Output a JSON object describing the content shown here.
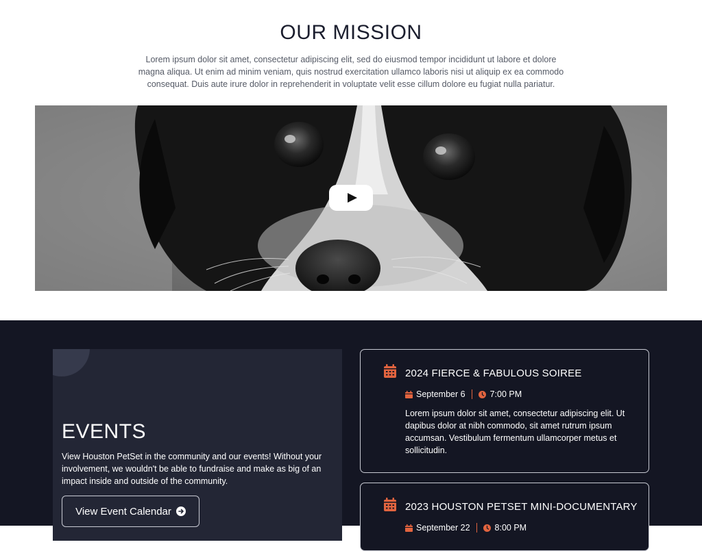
{
  "mission": {
    "title": "OUR MISSION",
    "text": "Lorem ipsum dolor sit amet, consectetur adipiscing elit, sed do eiusmod tempor incididunt ut labore et dolore magna aliqua. Ut enim ad minim veniam, quis nostrud exercitation ullamco laboris nisi ut aliquip ex ea commodo consequat. Duis aute irure dolor in reprehenderit in voluptate velit esse cillum dolore eu fugiat nulla pariatur.",
    "video": {
      "play_icon": "play-icon",
      "subject": "black-and-white dog close-up"
    }
  },
  "events": {
    "title": "EVENTS",
    "text": "View Houston PetSet in the community and our events! Without your involvement, we wouldn't be able to fundraise and make as big of an impact inside and outside of the community.",
    "button_label": "View Event Calendar",
    "button_icon": "arrow-right-circle-icon",
    "items": [
      {
        "title": "2024 FIERCE & FABULOUS SOIREE",
        "date": "September 6",
        "time": "7:00 PM",
        "description": "Lorem ipsum dolor sit amet, consectetur adipiscing elit. Ut dapibus dolor at nibh commodo, sit amet rutrum ipsum accumsan. Vestibulum fermentum ullamcorper metus et sollicitudin."
      },
      {
        "title": "2023 HOUSTON PETSET MINI-DOCUMENTARY",
        "date": "September 22",
        "time": "8:00 PM",
        "description": ""
      }
    ]
  },
  "colors": {
    "dark_background": "#141623",
    "panel_background": "#232635",
    "accent": "#e2643f",
    "heading": "#1b1e2e"
  }
}
